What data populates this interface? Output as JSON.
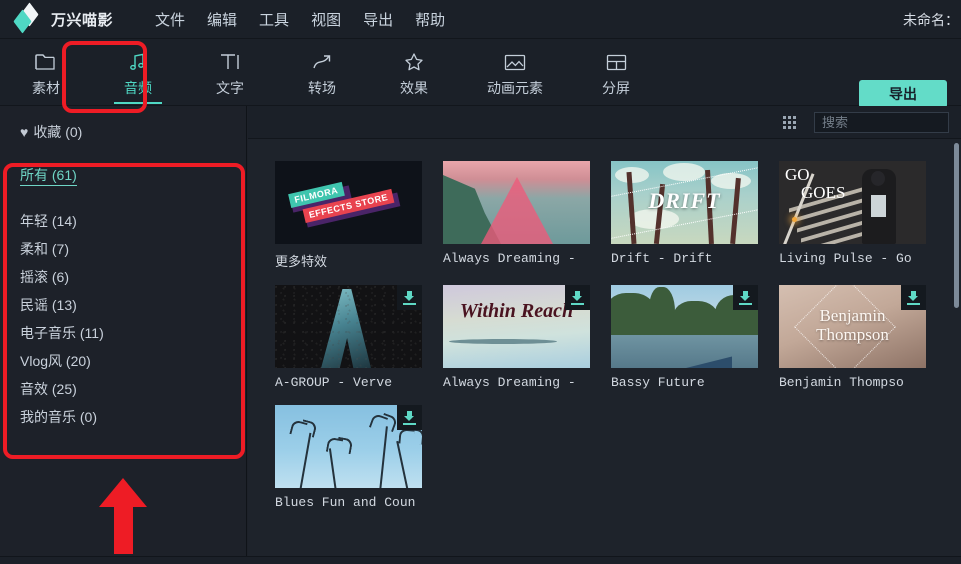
{
  "app": {
    "brand_name": "万兴喵影",
    "accent_color": "#4fd8c4",
    "annotation_color": "#ee1c25",
    "project_title": "未命名："
  },
  "menu": {
    "items": [
      {
        "label": "文件",
        "name": "menu-file"
      },
      {
        "label": "编辑",
        "name": "menu-edit"
      },
      {
        "label": "工具",
        "name": "menu-tools"
      },
      {
        "label": "视图",
        "name": "menu-view"
      },
      {
        "label": "导出",
        "name": "menu-export"
      },
      {
        "label": "帮助",
        "name": "menu-help"
      }
    ]
  },
  "toolbar": {
    "tabs": [
      {
        "label": "素材",
        "icon": "folder-icon",
        "active": false
      },
      {
        "label": "音频",
        "icon": "music-note-icon",
        "active": true
      },
      {
        "label": "文字",
        "icon": "text-icon",
        "active": false
      },
      {
        "label": "转场",
        "icon": "transition-icon",
        "active": false
      },
      {
        "label": "效果",
        "icon": "sparkle-icon",
        "active": false
      },
      {
        "label": "动画元素",
        "icon": "image-icon",
        "active": false
      },
      {
        "label": "分屏",
        "icon": "split-screen-icon",
        "active": false
      }
    ],
    "export_label": "导出"
  },
  "sidebar": {
    "favorites": {
      "label": "收藏 (0)",
      "icon": "heart-icon"
    },
    "categories": [
      {
        "label": "所有 (61)",
        "active": true
      },
      {
        "label": "年轻 (14)",
        "active": false
      },
      {
        "label": "柔和 (7)",
        "active": false
      },
      {
        "label": "摇滚 (6)",
        "active": false
      },
      {
        "label": "民谣 (13)",
        "active": false
      },
      {
        "label": "电子音乐 (11)",
        "active": false
      },
      {
        "label": "Vlog风 (20)",
        "active": false
      },
      {
        "label": "音效 (25)",
        "active": false
      },
      {
        "label": "我的音乐 (0)",
        "active": false
      }
    ]
  },
  "content": {
    "search": {
      "value": "",
      "placeholder": "搜索"
    },
    "grid_view_icon": "grid-view-icon",
    "search_icon": "search-icon",
    "items": [
      {
        "title": "更多特效",
        "art": "store",
        "downloadable": false
      },
      {
        "title": "Always Dreaming -",
        "art": "coast",
        "downloadable": false
      },
      {
        "title": "Drift - Drift",
        "art": "drift",
        "downloadable": false,
        "overlay_text": "DRIFT"
      },
      {
        "title": "Living Pulse - Go",
        "art": "stairs",
        "downloadable": false,
        "overlay_text": "GO GOES"
      },
      {
        "title": "A-GROUP - Verve",
        "art": "verve",
        "downloadable": true
      },
      {
        "title": "Always Dreaming -",
        "art": "reach",
        "downloadable": true,
        "overlay_text": "Within Reach"
      },
      {
        "title": "Bassy Future",
        "art": "bay",
        "downloadable": true
      },
      {
        "title": "Benjamin Thompso",
        "art": "benjamin",
        "downloadable": true,
        "overlay_text": "Benjamin Thompson"
      },
      {
        "title": "Blues Fun and Coun",
        "art": "palm",
        "downloadable": true
      }
    ]
  }
}
